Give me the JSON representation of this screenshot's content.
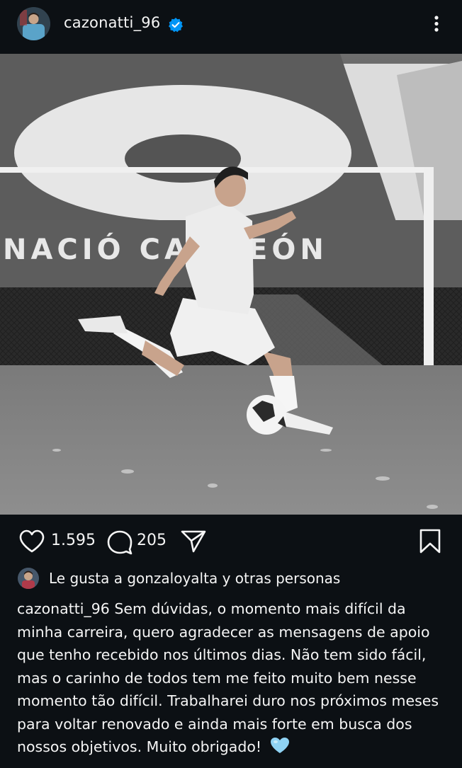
{
  "post": {
    "username": "cazonatti_96",
    "photo_banner_text": "NACIÓ CAMPEÓN",
    "likes_count": "1.595",
    "comments_count": "205",
    "liked_by_text": "Le gusta a gonzaloyalta y otras personas",
    "caption_user": "cazonatti_96",
    "caption_text": "Sem dúvidas, o momento mais difícil da minha carreira, quero agradecer as mensagens de apoio que tenho recebido nos últimos dias. Não tem sido fácil, mas o carinho de todos tem me feito muito bem nesse momento tão difícil. Trabalharei duro nos próximos meses para voltar renovado e ainda mais forte em busca dos nossos objetivos. Muito obrigado!"
  },
  "icons": {
    "verified": "verified-badge-icon",
    "more": "more-vertical-icon",
    "like": "heart-outline-icon",
    "comment": "comment-bubble-icon",
    "share": "paper-plane-icon",
    "save": "bookmark-icon",
    "emoji": "light-blue-heart-emoji"
  },
  "colors": {
    "background": "#0c1014",
    "text": "#f5f5f5",
    "verified": "#0095f6",
    "emoji_heart": "#8fd3f4"
  }
}
